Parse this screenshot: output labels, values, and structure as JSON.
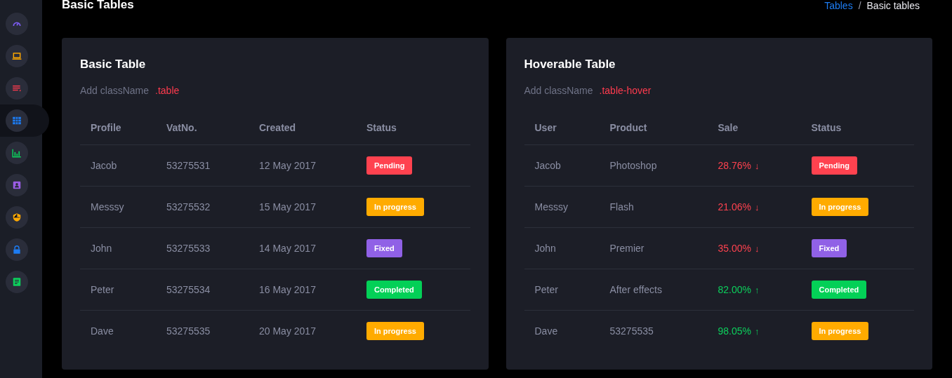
{
  "sidebar": {
    "items": [
      {
        "selected": false
      },
      {
        "selected": false
      },
      {
        "selected": false
      },
      {
        "selected": true
      },
      {
        "selected": false
      },
      {
        "selected": false
      },
      {
        "selected": false
      },
      {
        "selected": false
      },
      {
        "selected": false
      }
    ]
  },
  "page_title": "Basic Tables",
  "breadcrumb": [
    {
      "label": "Tables",
      "link": true
    },
    {
      "label": "Basic tables",
      "link": false
    }
  ],
  "breadcrumb_separator": "/",
  "cards": [
    {
      "title": "Basic Table",
      "hint": "Add className",
      "class_name": ".table",
      "columns": [
        "Profile",
        "VatNo.",
        "Created",
        "Status"
      ],
      "rows": [
        {
          "cells": [
            {
              "kind": "text",
              "text": "Jacob"
            },
            {
              "kind": "text",
              "text": "53275531"
            },
            {
              "kind": "text",
              "text": "12 May 2017"
            },
            {
              "kind": "status",
              "text": "Pending",
              "color": "#ff424f"
            }
          ]
        },
        {
          "cells": [
            {
              "kind": "text",
              "text": "Messsy"
            },
            {
              "kind": "text",
              "text": "53275532"
            },
            {
              "kind": "text",
              "text": "15 May 2017"
            },
            {
              "kind": "status",
              "text": "In progress",
              "color": "#ffab00"
            }
          ]
        },
        {
          "cells": [
            {
              "kind": "text",
              "text": "John"
            },
            {
              "kind": "text",
              "text": "53275533"
            },
            {
              "kind": "text",
              "text": "14 May 2017"
            },
            {
              "kind": "status",
              "text": "Fixed",
              "color": "#9061e6"
            }
          ]
        },
        {
          "cells": [
            {
              "kind": "text",
              "text": "Peter"
            },
            {
              "kind": "text",
              "text": "53275534"
            },
            {
              "kind": "text",
              "text": "16 May 2017"
            },
            {
              "kind": "status",
              "text": "Completed",
              "color": "#03d057"
            }
          ]
        },
        {
          "cells": [
            {
              "kind": "text",
              "text": "Dave"
            },
            {
              "kind": "text",
              "text": "53275535"
            },
            {
              "kind": "text",
              "text": "20 May 2017"
            },
            {
              "kind": "status",
              "text": "In progress",
              "color": "#ffab00"
            }
          ]
        }
      ]
    },
    {
      "title": "Hoverable Table",
      "hint": "Add className",
      "class_name": ".table-hover",
      "columns": [
        "User",
        "Product",
        "Sale",
        "Status"
      ],
      "rows": [
        {
          "cells": [
            {
              "kind": "text",
              "text": "Jacob"
            },
            {
              "kind": "text",
              "text": "Photoshop"
            },
            {
              "kind": "sale",
              "text": "28.76%",
              "arrow": "↓",
              "color": "#ff424f"
            },
            {
              "kind": "status",
              "text": "Pending",
              "color": "#ff424f"
            }
          ]
        },
        {
          "cells": [
            {
              "kind": "text",
              "text": "Messsy"
            },
            {
              "kind": "text",
              "text": "Flash"
            },
            {
              "kind": "sale",
              "text": "21.06%",
              "arrow": "↓",
              "color": "#ff424f"
            },
            {
              "kind": "status",
              "text": "In progress",
              "color": "#ffab00"
            }
          ]
        },
        {
          "cells": [
            {
              "kind": "text",
              "text": "John"
            },
            {
              "kind": "text",
              "text": "Premier"
            },
            {
              "kind": "sale",
              "text": "35.00%",
              "arrow": "↓",
              "color": "#ff424f"
            },
            {
              "kind": "status",
              "text": "Fixed",
              "color": "#9061e6"
            }
          ]
        },
        {
          "cells": [
            {
              "kind": "text",
              "text": "Peter"
            },
            {
              "kind": "text",
              "text": "After effects"
            },
            {
              "kind": "sale",
              "text": "82.00%",
              "arrow": "↑",
              "color": "#0ccf5c"
            },
            {
              "kind": "status",
              "text": "Completed",
              "color": "#03d057"
            }
          ]
        },
        {
          "cells": [
            {
              "kind": "text",
              "text": "Dave"
            },
            {
              "kind": "text",
              "text": "53275535"
            },
            {
              "kind": "sale",
              "text": "98.05%",
              "arrow": "↑",
              "color": "#0ccf5c"
            },
            {
              "kind": "status",
              "text": "In progress",
              "color": "#ffab00"
            }
          ]
        }
      ]
    }
  ]
}
